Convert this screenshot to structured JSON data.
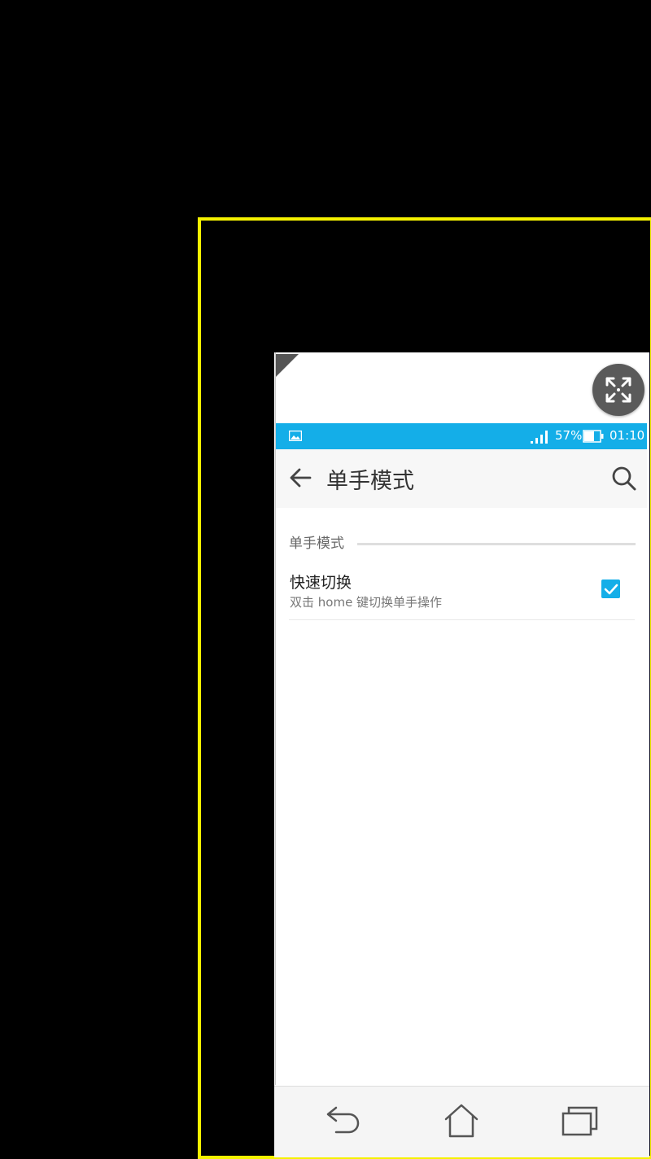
{
  "status_bar": {
    "battery_text": "57%",
    "time": "01:10",
    "icons": [
      "image-notification-icon",
      "signal-icon",
      "battery-icon"
    ]
  },
  "app_bar": {
    "title": "单手模式",
    "back_icon": "back-arrow-icon",
    "search_icon": "search-icon"
  },
  "section": {
    "header": "单手模式"
  },
  "settings": [
    {
      "title": "快速切换",
      "subtitle": "双击 home 键切换单手操作",
      "checked": true
    }
  ],
  "overlay": {
    "expand_icon": "expand-arrows-icon"
  },
  "nav_bar": {
    "icons": [
      "back-icon",
      "home-icon",
      "recents-icon"
    ]
  },
  "colors": {
    "accent": "#14aee8",
    "frame": "#f5f200"
  }
}
